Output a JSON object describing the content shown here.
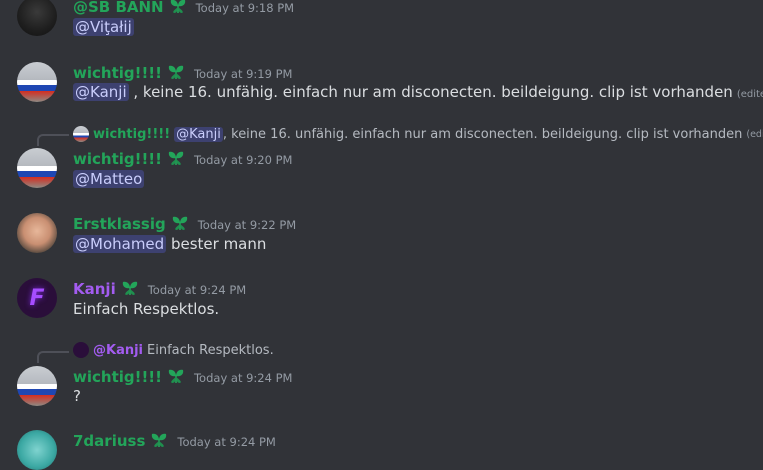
{
  "messages": [
    {
      "author": "@SB BANN",
      "time": "Today at 9:18 PM",
      "mention": "@Viţałij",
      "text": "",
      "badge": "leaf-badge-icon"
    },
    {
      "author": "wichtig!!!!",
      "time": "Today at 9:19 PM",
      "mention": "@Kanji",
      "text": " , keine 16. unfähig. einfach nur am disconecten. beildeigung. clip ist vorhanden",
      "edited": "(edited)",
      "badge": "leaf-badge-icon"
    },
    {
      "author": "wichtig!!!!",
      "time": "Today at 9:20 PM",
      "mention": "@Matteo",
      "text": "",
      "reply": {
        "author": "wichtig!!!!",
        "mention": "@Kanji",
        "text": " , keine 16. unfähig. einfach nur am disconecten. beildeigung. clip ist vorhanden",
        "edited": "(edited)"
      }
    },
    {
      "author": "Erstklassig",
      "time": "Today at 9:22 PM",
      "mention": "@Mohamed",
      "text": " bester mann"
    },
    {
      "author": "Kanji",
      "time": "Today at 9:24 PM",
      "mention": "",
      "text": "Einfach Respektlos."
    },
    {
      "author": "wichtig!!!!",
      "time": "Today at 9:24 PM",
      "mention": "",
      "text": "?",
      "reply": {
        "author": "@Kanji",
        "mention": "",
        "text": "Einfach Respektlos."
      }
    },
    {
      "author": "7dariuss",
      "time": "Today at 9:24 PM"
    }
  ],
  "colors": {
    "background": "#313338",
    "green_name": "#23a55a",
    "purple_name": "#a35cf0",
    "mention_bg": "rgba(88,101,242,0.3)",
    "text": "#dbdee1",
    "muted": "#949ba4"
  }
}
